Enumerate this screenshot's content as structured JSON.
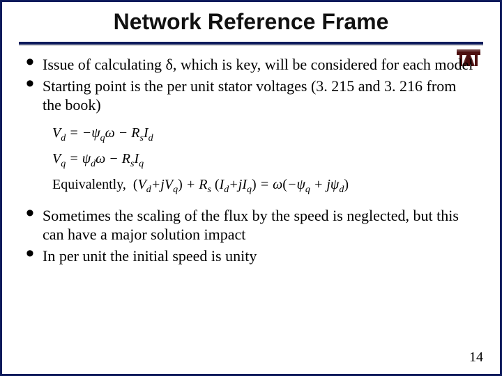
{
  "title": "Network Reference Frame",
  "logo": {
    "name": "tamu-logo",
    "primary": "#4d0f0f",
    "accent": "#ffffff"
  },
  "bullets_top": [
    "Issue of calculating δ, which is key, will be considered for each model",
    "Starting point is the per unit stator voltages (3. 215 and 3. 216 from the book)"
  ],
  "equations": {
    "vd": "V_d = −ψ_q ω − R_s I_d",
    "vq": "V_q = ψ_d ω − R_s I_q",
    "equiv_label": "Equivalently,",
    "equiv": "(V_d + jV_q) + R_s (I_d + jI_q) = ω (−ψ_q + jψ_d)"
  },
  "bullets_bottom": [
    "Sometimes the scaling of the flux by the speed is neglected, but this can have a major solution impact",
    "In per unit the initial speed is unity"
  ],
  "page_number": "14"
}
